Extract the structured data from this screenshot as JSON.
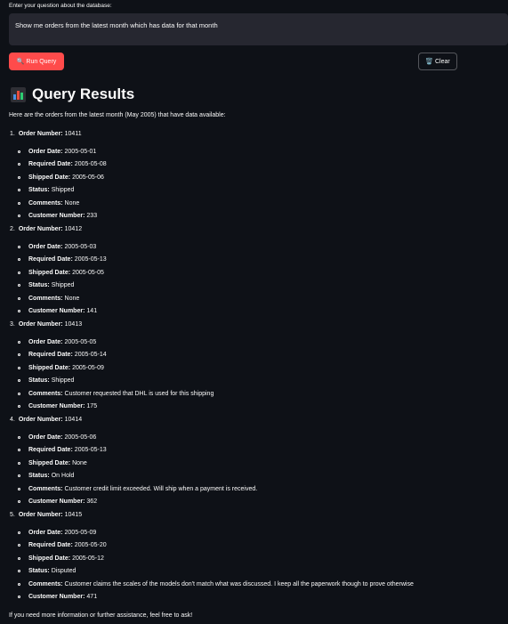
{
  "prompt": {
    "label": "Enter your question about the database:",
    "value": "Show me orders from the latest month which has data for that month"
  },
  "buttons": {
    "run_icon": "🔍",
    "run_label": "Run Query",
    "clear_icon": "🗑️",
    "clear_label": "Clear"
  },
  "results": {
    "title": "Query Results",
    "intro": "Here are the orders from the latest month (May 2005) that have data available:",
    "closing": "If you need more information or further assistance, feel free to ask!",
    "field_labels": {
      "order_date": "Order Date:",
      "required_date": "Required Date:",
      "shipped_date": "Shipped Date:",
      "status": "Status:",
      "comments": "Comments:",
      "customer_number": "Customer Number:"
    },
    "order_number_label": "Order Number:",
    "orders": [
      {
        "index": "1.",
        "order_number": "10411",
        "order_date": "2005-05-01",
        "required_date": "2005-05-08",
        "shipped_date": "2005-05-06",
        "status": "Shipped",
        "comments": "None",
        "customer_number": "233"
      },
      {
        "index": "2.",
        "order_number": "10412",
        "order_date": "2005-05-03",
        "required_date": "2005-05-13",
        "shipped_date": "2005-05-05",
        "status": "Shipped",
        "comments": "None",
        "customer_number": "141"
      },
      {
        "index": "3.",
        "order_number": "10413",
        "order_date": "2005-05-05",
        "required_date": "2005-05-14",
        "shipped_date": "2005-05-09",
        "status": "Shipped",
        "comments": "Customer requested that DHL is used for this shipping",
        "customer_number": "175"
      },
      {
        "index": "4.",
        "order_number": "10414",
        "order_date": "2005-05-06",
        "required_date": "2005-05-13",
        "shipped_date": "None",
        "status": "On Hold",
        "comments": "Customer credit limit exceeded. Will ship when a payment is received.",
        "customer_number": "362"
      },
      {
        "index": "5.",
        "order_number": "10415",
        "order_date": "2005-05-09",
        "required_date": "2005-05-20",
        "shipped_date": "2005-05-12",
        "status": "Disputed",
        "comments": "Customer claims the scales of the models don't match what was discussed. I keep all the paperwork though to prove otherwise",
        "customer_number": "471"
      }
    ]
  }
}
